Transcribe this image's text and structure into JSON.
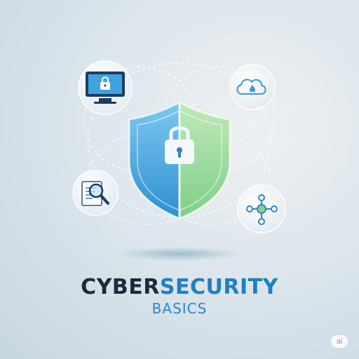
{
  "title": {
    "part1": "CYBER",
    "part2": "SECURITY"
  },
  "subtitle": "BASICS",
  "badge": "ai",
  "icons": [
    "monitor-lock-icon",
    "cloud-icon",
    "document-search-icon",
    "network-nodes-icon",
    "shield-lock-icon"
  ],
  "colors": {
    "accent_blue": "#1f7fc4",
    "dark_text": "#1a2a3e",
    "shield_blue": "#4fb0e6",
    "shield_green": "#8ed18a"
  }
}
